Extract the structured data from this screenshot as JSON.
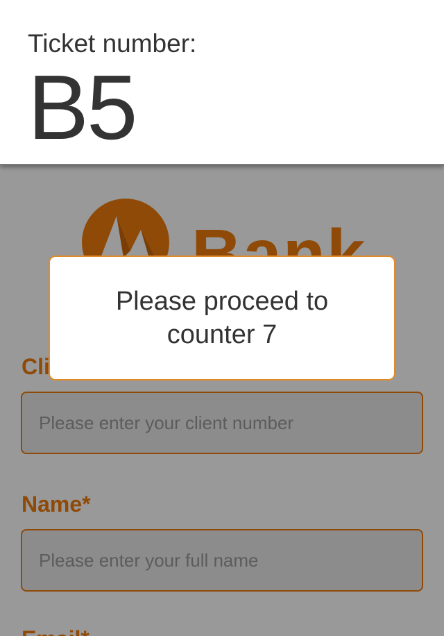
{
  "ticket": {
    "label": "Ticket number:",
    "number": "B5"
  },
  "logo": {
    "text": "Bank",
    "icon": "mountain-logo-icon"
  },
  "modal": {
    "message": "Please proceed to counter 7"
  },
  "form": {
    "client_label": "Client number*",
    "client_placeholder": "Please enter your client number",
    "name_label": "Name*",
    "name_placeholder": "Please enter your full name",
    "email_label": "Email*"
  },
  "colors": {
    "brand": "#8f4a07",
    "modal_border": "#e08a2a",
    "overlay": "#999999"
  }
}
